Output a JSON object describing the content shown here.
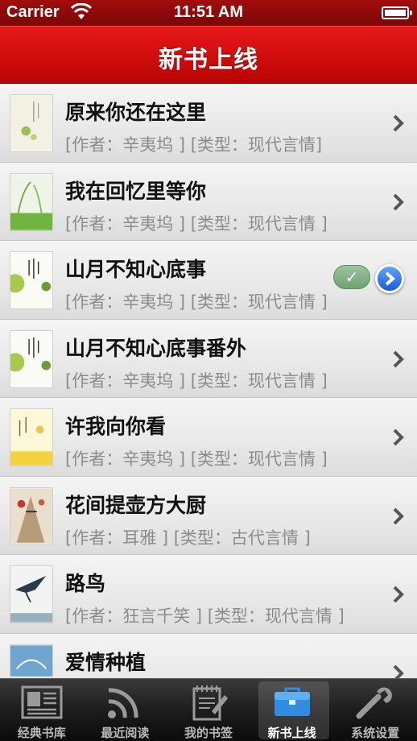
{
  "status_bar": {
    "carrier": "Carrier",
    "time": "11:51 AM"
  },
  "nav": {
    "title": "新书上线"
  },
  "books": [
    {
      "title": "原来你还在这里",
      "meta": "[作者：辛夷坞 ] [类型：现代言情]",
      "cover_icon": "book-cover-icon"
    },
    {
      "title": "我在回忆里等你",
      "meta": "[作者：辛夷坞 ] [类型：现代言情 ]",
      "cover_icon": "book-cover-icon"
    },
    {
      "title": "山月不知心底事",
      "meta": "[作者：辛夷坞 ] [类型：现代言情 ]",
      "cover_icon": "book-cover-icon",
      "selected": true
    },
    {
      "title": "山月不知心底事番外",
      "meta": "[作者：辛夷坞 ] [类型：现代言情 ]",
      "cover_icon": "book-cover-icon"
    },
    {
      "title": "许我向你看",
      "meta": "[作者：辛夷坞 ] [类型：现代言情 ]",
      "cover_icon": "book-cover-icon"
    },
    {
      "title": "花间提壶方大厨",
      "meta": "[作者：耳雅 ] [类型：古代言情 ]",
      "cover_icon": "book-cover-icon"
    },
    {
      "title": "路鸟",
      "meta": "[作者：狂言千笑 ] [类型：现代言情 ]",
      "cover_icon": "book-cover-icon"
    },
    {
      "title": "爱情种植",
      "meta": "",
      "cover_icon": "book-cover-icon"
    }
  ],
  "tabs": [
    {
      "label": "经典书库",
      "icon": "newspaper-icon"
    },
    {
      "label": "最近阅读",
      "icon": "rss-icon"
    },
    {
      "label": "我的书签",
      "icon": "notepad-icon"
    },
    {
      "label": "新书上线",
      "icon": "toolbox-icon",
      "active": true
    },
    {
      "label": "系统设置",
      "icon": "wrench-icon"
    }
  ],
  "colors": {
    "nav_red": "#d30d0d",
    "accent_blue": "#1b5ad8",
    "check_green": "#6ea272"
  }
}
